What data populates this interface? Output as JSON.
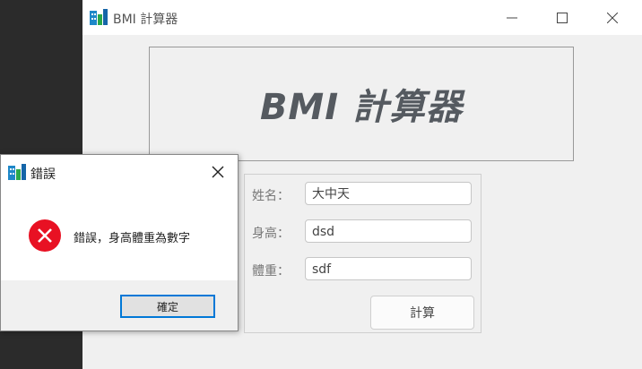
{
  "main_window": {
    "title": "BMI 計算器",
    "header_text": "BMI 計算器",
    "form": {
      "name_label": "姓名：",
      "name_value": "大中天",
      "height_label": "身高：",
      "height_value": "dsd",
      "weight_label": "體重：",
      "weight_value": "sdf",
      "calc_button": "計算"
    }
  },
  "dialog": {
    "title": "錯誤",
    "message": "錯誤，身高體重為數字",
    "ok_button": "確定"
  },
  "icons": {
    "app": "app-icon",
    "minimize": "minimize-icon",
    "maximize": "maximize-icon",
    "close": "close-icon",
    "error": "error-icon"
  },
  "colors": {
    "error_red": "#e81123",
    "focus_blue": "#0078d7"
  }
}
